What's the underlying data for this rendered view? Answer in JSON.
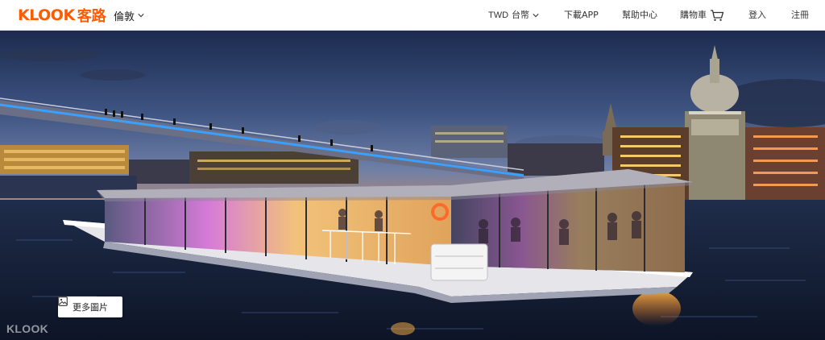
{
  "header": {
    "logo_latin": "KLOOK",
    "logo_cjk": "客路",
    "city": "倫敦",
    "currency_code": "TWD",
    "currency_name": "台幣",
    "download_app": "下載APP",
    "help_center": "幫助中心",
    "cart": "購物車",
    "login": "登入",
    "register": "注冊"
  },
  "hero": {
    "more_photos": "更多圖片",
    "watermark": "KLOOK"
  },
  "colors": {
    "brand": "#ff5b00",
    "header_bg": "#ffffff",
    "text": "#222222"
  },
  "icons": [
    "chevron-down-icon",
    "cart-icon",
    "image-icon"
  ]
}
